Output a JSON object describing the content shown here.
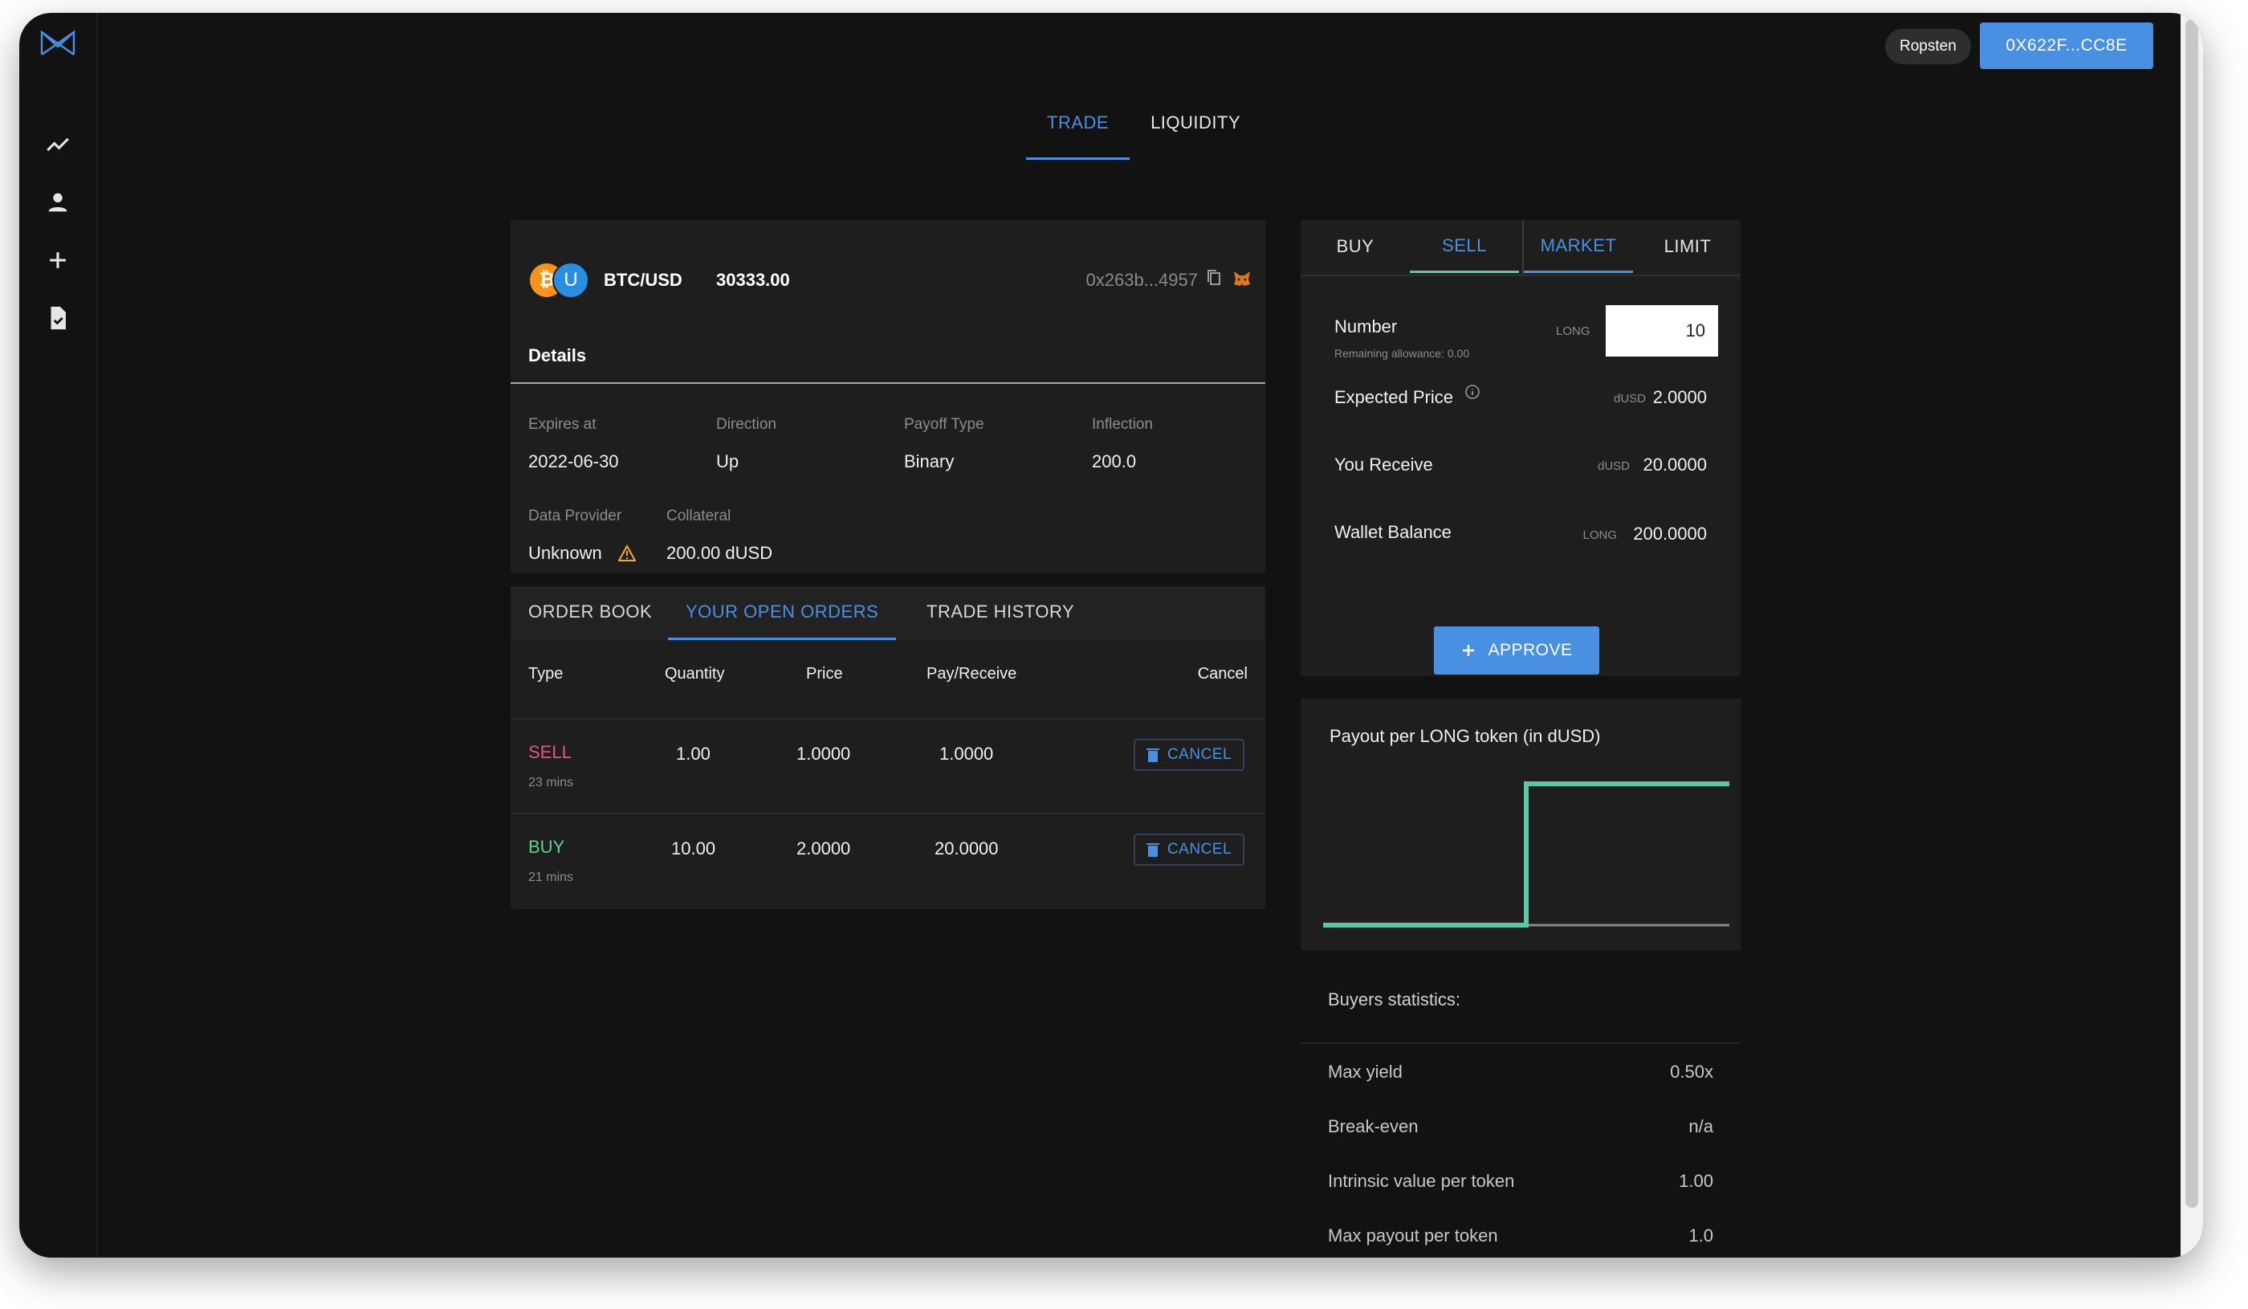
{
  "header": {
    "network": "Ropsten",
    "wallet": "0X622F...CC8E"
  },
  "nav": {
    "tabs": [
      {
        "label": "TRADE",
        "active": true
      },
      {
        "label": "LIQUIDITY",
        "active": false
      }
    ]
  },
  "sidebar": {
    "icons": [
      "chart-line-icon",
      "person-icon",
      "plus-icon",
      "document-check-icon"
    ]
  },
  "instrument": {
    "coin_left": "₿",
    "coin_right": "U",
    "pair": "BTC/USD",
    "price": "30333.00",
    "address": "0x263b...4957",
    "details_title": "Details",
    "fields": {
      "expires_label": "Expires at",
      "expires_value": "2022-06-30",
      "direction_label": "Direction",
      "direction_value": "Up",
      "payoff_label": "Payoff Type",
      "payoff_value": "Binary",
      "inflection_label": "Inflection",
      "inflection_value": "200.0",
      "provider_label": "Data Provider",
      "provider_value": "Unknown",
      "collateral_label": "Collateral",
      "collateral_value": "200.00 dUSD"
    }
  },
  "orders": {
    "tabs": [
      {
        "label": "ORDER BOOK",
        "active": false
      },
      {
        "label": "YOUR OPEN ORDERS",
        "active": true
      },
      {
        "label": "TRADE HISTORY",
        "active": false
      }
    ],
    "columns": [
      "Type",
      "Quantity",
      "Price",
      "Pay/Receive",
      "Cancel"
    ],
    "rows": [
      {
        "type": "SELL",
        "age": "23 mins",
        "quantity": "1.00",
        "price": "1.0000",
        "pay_receive": "1.0000",
        "cancel": "CANCEL"
      },
      {
        "type": "BUY",
        "age": "21 mins",
        "quantity": "10.00",
        "price": "2.0000",
        "pay_receive": "20.0000",
        "cancel": "CANCEL"
      }
    ]
  },
  "trade_form": {
    "side_tabs": [
      {
        "label": "BUY",
        "active": false
      },
      {
        "label": "SELL",
        "active": true
      }
    ],
    "type_tabs": [
      {
        "label": "MARKET",
        "active": true
      },
      {
        "label": "LIMIT",
        "active": false
      }
    ],
    "number_label": "Number",
    "allowance": "Remaining allowance: 0.00",
    "number_unit": "LONG",
    "number_value": "10",
    "expected_price_label": "Expected Price",
    "expected_price_unit": "dUSD",
    "expected_price_value": "2.0000",
    "you_receive_label": "You Receive",
    "you_receive_unit": "dUSD",
    "you_receive_value": "20.0000",
    "wallet_balance_label": "Wallet Balance",
    "wallet_balance_unit": "LONG",
    "wallet_balance_value": "200.0000",
    "approve_label": "APPROVE"
  },
  "chart_data": {
    "type": "line",
    "title": "Payout per LONG token (in dUSD)",
    "xlabel": "",
    "ylabel": "",
    "series": [
      {
        "x": [
          0,
          0.5,
          0.5,
          1
        ],
        "values": [
          0,
          0,
          1,
          1
        ]
      }
    ],
    "grid": false,
    "color": "#5ac8a8"
  },
  "buyers_stats": {
    "title": "Buyers statistics:",
    "rows": [
      {
        "label": "Max yield",
        "value": "0.50x"
      },
      {
        "label": "Break-even",
        "value": "n/a"
      },
      {
        "label": "Intrinsic value per token",
        "value": "1.00"
      },
      {
        "label": "Max payout per token",
        "value": "1.0"
      }
    ]
  },
  "colors": {
    "accent": "#4a90e2",
    "sell": "#e05a7a",
    "buy": "#5ad292",
    "payout_line": "#5ac8a8"
  }
}
